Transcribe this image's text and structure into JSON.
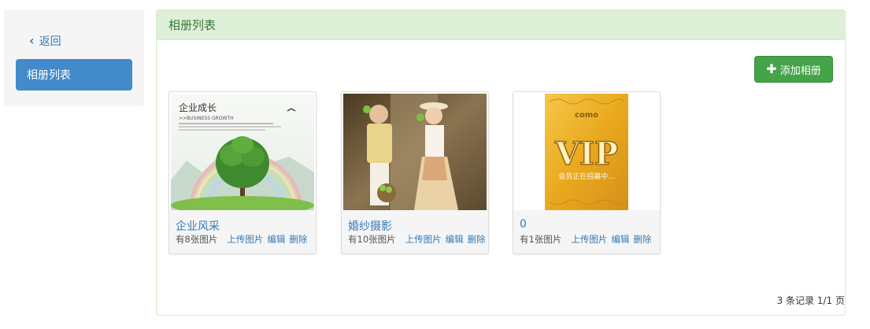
{
  "sidebar": {
    "back_label": "返回",
    "active_item": "相册列表"
  },
  "panel": {
    "title": "相册列表",
    "add_button": "添加相册"
  },
  "albums": [
    {
      "title": "企业风采",
      "count": "有8张图片",
      "upload": "上传图片",
      "edit": "编辑",
      "delete": "删除",
      "thumb_text": {
        "heading": "企业成长",
        "sub": ">>BUSINESS GROWTH"
      }
    },
    {
      "title": "婚纱摄影",
      "count": "有10张图片",
      "upload": "上传图片",
      "edit": "编辑",
      "delete": "删除"
    },
    {
      "title": "0",
      "count": "有1张图片",
      "upload": "上传图片",
      "edit": "编辑",
      "delete": "删除",
      "thumb_text": {
        "brand": "como",
        "vip": "VIP",
        "caption": "会员正在招募中..."
      }
    }
  ],
  "pagination": "3 条记录 1/1 页",
  "colors": {
    "primary": "#428bca",
    "link": "#337ab7",
    "success": "#45a449",
    "panel_heading_bg": "#dff0d8",
    "panel_heading_text": "#3c763d"
  }
}
